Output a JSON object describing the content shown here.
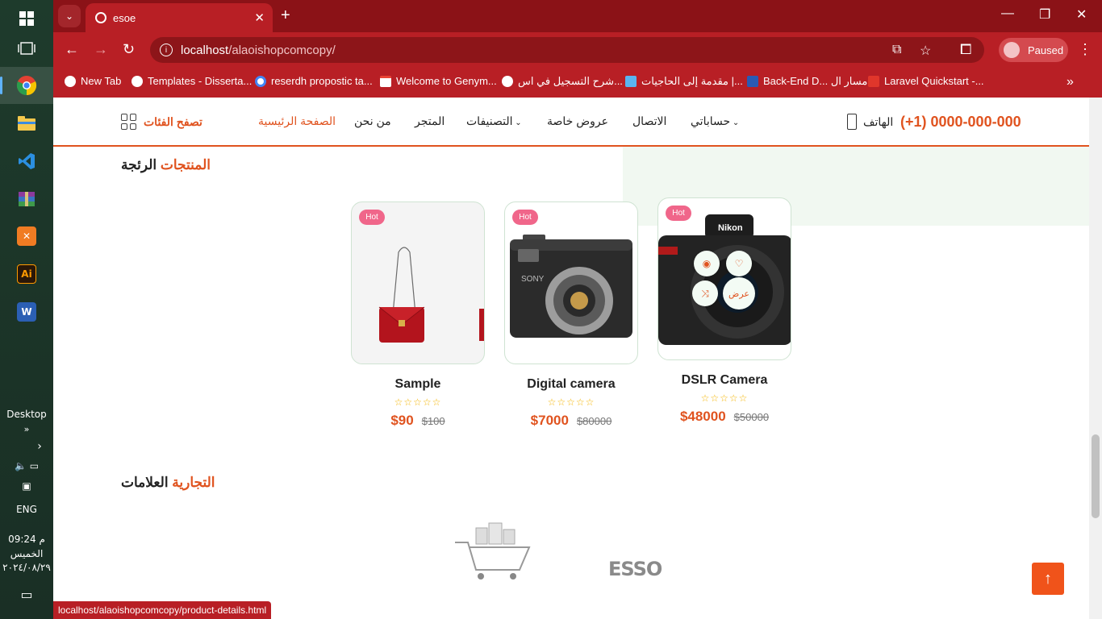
{
  "taskbar": {
    "desktop_label": "Desktop",
    "language": "ENG",
    "time": "09:24 م",
    "day": "الخميس",
    "date": "٢٠٢٤/٠٨/٢٩"
  },
  "browser": {
    "tab_title": "esoe",
    "url_host": "localhost",
    "url_path": "/alaoishopcomcopy/",
    "profile_status": "Paused",
    "bookmarks": [
      "New Tab",
      "Templates - Disserta...",
      "reserdh propostic ta...",
      "Welcome to Genym...",
      "شرح التسجيل في اس...",
      "مقدمة إلى الحاجيات |...",
      "Back-End D... مسار ال",
      "Laravel Quickstart -..."
    ],
    "status_url": "localhost/alaoishopcomcopy/product-details.html"
  },
  "site": {
    "phone": "(+1) 0000-000-000",
    "phone_label": "الهاتف",
    "nav": {
      "account": "حساباتي",
      "contact": "الاتصال",
      "offers": "عروض خاصة",
      "categories": "التصنيفات",
      "shop": "المتجر",
      "about": "من نحن",
      "home": "الصفحة الرئيسية",
      "browse": "تصفح الفئات"
    },
    "trending_title_a": "المنتجات",
    "trending_title_b": "الرئجة",
    "brands_title_a": "العلامات",
    "brands_title_b": "التجارية",
    "hot_label": "Hot",
    "view_label": "عرض",
    "products": [
      {
        "name": "Sample",
        "price": "$90",
        "old_price": "$100",
        "rating": 5
      },
      {
        "name": "Digital camera",
        "price": "$7000",
        "old_price": "$80000",
        "rating": 5
      },
      {
        "name": "DSLR Camera",
        "price": "$48000",
        "old_price": "$50000",
        "rating": 5
      }
    ],
    "brands": [
      "ESSO"
    ]
  },
  "colors": {
    "accent": "#e0531f",
    "browser_frame": "#b81f25",
    "hot_badge": "#f0668a"
  }
}
